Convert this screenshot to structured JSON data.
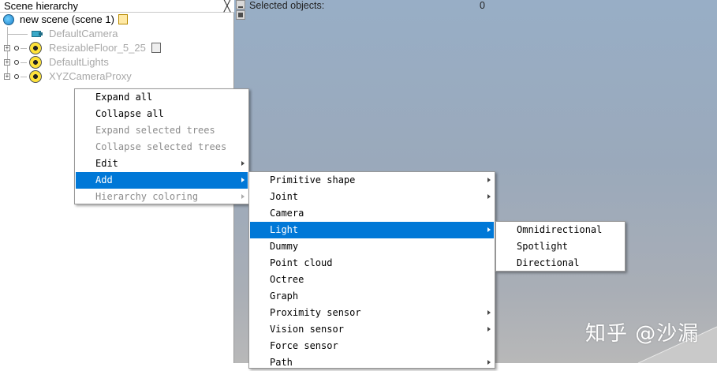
{
  "scene_hierarchy": {
    "title": "Scene hierarchy",
    "close_glyph": "╳",
    "root_label": "new scene (scene 1)",
    "nodes": [
      {
        "label": "DefaultCamera",
        "icon": "camera-icon"
      },
      {
        "label": "ResizableFloor_5_25",
        "icon": "shape-icon"
      },
      {
        "label": "DefaultLights",
        "icon": "dummy-icon"
      },
      {
        "label": "XYZCameraProxy",
        "icon": "dummy-icon"
      }
    ]
  },
  "viewport": {
    "selected_label": "Selected objects:",
    "selected_count": "0",
    "watermark": "知乎 @沙漏"
  },
  "context_menu": {
    "items": [
      {
        "label": "Expand all",
        "enabled": true,
        "submenu": false
      },
      {
        "label": "Collapse all",
        "enabled": true,
        "submenu": false
      },
      {
        "label": "Expand selected trees",
        "enabled": false,
        "submenu": false
      },
      {
        "label": "Collapse selected trees",
        "enabled": false,
        "submenu": false
      },
      {
        "label": "Edit",
        "enabled": true,
        "submenu": true
      },
      {
        "label": "Add",
        "enabled": true,
        "submenu": true,
        "active": true
      },
      {
        "label": "Hierarchy coloring",
        "enabled": false,
        "submenu": true
      }
    ]
  },
  "add_menu": {
    "items": [
      {
        "label": "Primitive shape",
        "submenu": true
      },
      {
        "label": "Joint",
        "submenu": true
      },
      {
        "label": "Camera",
        "submenu": false
      },
      {
        "label": "Light",
        "submenu": true,
        "active": true
      },
      {
        "label": "Dummy",
        "submenu": false
      },
      {
        "label": "Point cloud",
        "submenu": false
      },
      {
        "label": "Octree",
        "submenu": false
      },
      {
        "label": "Graph",
        "submenu": false
      },
      {
        "label": "Proximity sensor",
        "submenu": true
      },
      {
        "label": "Vision sensor",
        "submenu": true
      },
      {
        "label": "Force sensor",
        "submenu": false
      },
      {
        "label": "Path",
        "submenu": true
      }
    ]
  },
  "light_menu": {
    "items": [
      {
        "label": "Omnidirectional"
      },
      {
        "label": "Spotlight"
      },
      {
        "label": "Directional"
      }
    ]
  },
  "colors": {
    "menu_highlight": "#0078d7",
    "disabled_text": "#8c8c8c",
    "tree_node_text": "#a8a8a8"
  }
}
